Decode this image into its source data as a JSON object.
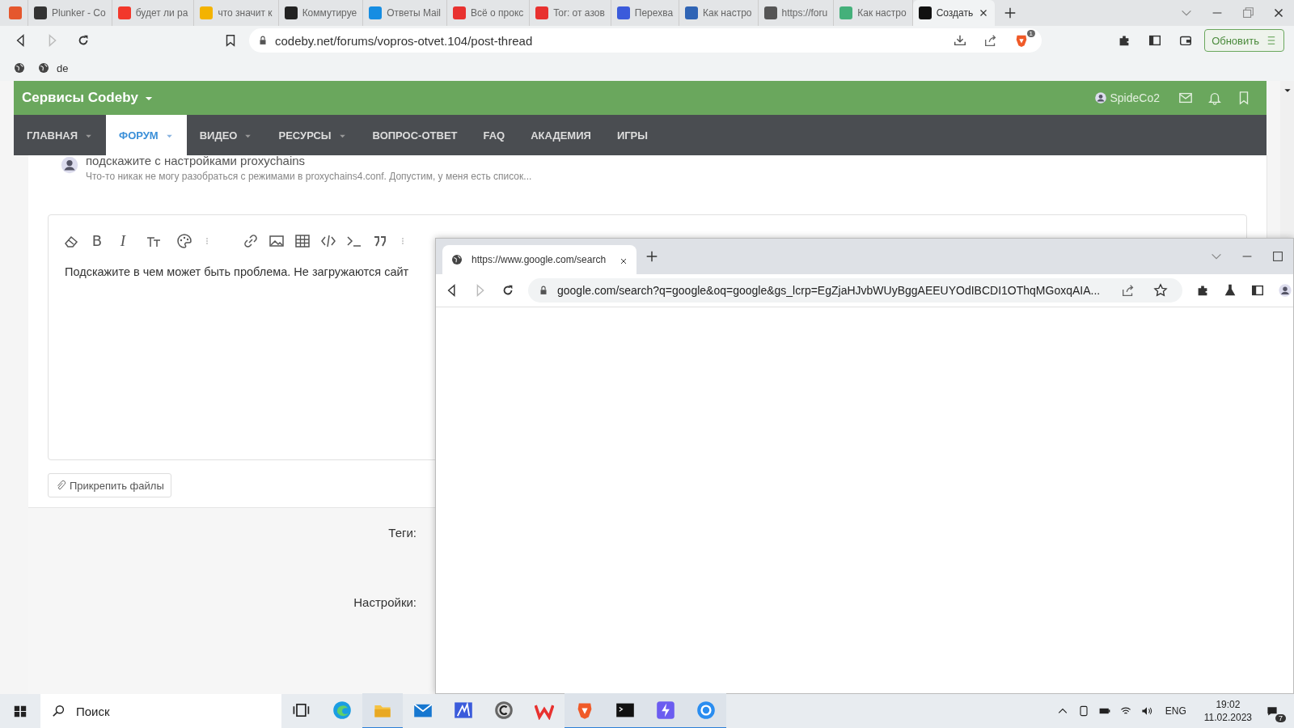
{
  "browser": {
    "tabs": [
      {
        "selected": false
      },
      {
        "label": "Plunker - Co",
        "selected": false
      },
      {
        "label": "будет ли ра",
        "selected": false
      },
      {
        "label": "что значит к",
        "selected": false
      },
      {
        "label": "Коммутируе",
        "selected": false
      },
      {
        "label": "Ответы Mail",
        "selected": false
      },
      {
        "label": "Всё о прокс",
        "selected": false
      },
      {
        "label": "Tor: от азов",
        "selected": false
      },
      {
        "label": "Перехва",
        "selected": false
      },
      {
        "label": "Как настро",
        "selected": false
      },
      {
        "label": "https://foru",
        "selected": false
      },
      {
        "label": "Как настро",
        "selected": false
      },
      {
        "label": "Создать",
        "selected": true
      }
    ],
    "url": "codeby.net/forums/vopros-otvet.104/post-thread",
    "extension_badge": "1",
    "update_button": "Обновить",
    "bookmarks": [
      {
        "kind": "icon"
      },
      {
        "kind": "link",
        "label": "de"
      }
    ]
  },
  "forum": {
    "brand": "Сервисы Codeby",
    "user": "SpideCo2",
    "nav": [
      {
        "label": "ГЛАВНАЯ",
        "selected": false,
        "dropdown": true
      },
      {
        "label": "ФОРУМ",
        "selected": true,
        "dropdown": true
      },
      {
        "label": "ВИДЕО",
        "selected": false,
        "dropdown": true
      },
      {
        "label": "РЕСУРСЫ",
        "selected": false,
        "dropdown": true
      },
      {
        "label": "ВОПРОС-ОТВЕТ",
        "selected": false,
        "dropdown": false
      },
      {
        "label": "FAQ",
        "selected": false,
        "dropdown": false
      },
      {
        "label": "АКАДЕМИЯ",
        "selected": false,
        "dropdown": false
      },
      {
        "label": "ИГРЫ",
        "selected": false,
        "dropdown": false
      }
    ],
    "similar_thread": {
      "title": "подскажите с настройками proxychains",
      "excerpt": "Что-то никак не могу разобраться с режимами в proxychains4.conf. Допустим, у меня есть список..."
    },
    "toolbar": [
      {
        "kind": "eraser"
      },
      {
        "kind": "bold",
        "label": "B"
      },
      {
        "kind": "italic",
        "label": "I"
      },
      {
        "kind": "textsize"
      },
      {
        "kind": "palette"
      },
      {
        "kind": "more"
      },
      {
        "kind": "link"
      },
      {
        "kind": "image"
      },
      {
        "kind": "table"
      },
      {
        "kind": "code"
      },
      {
        "kind": "terminal"
      },
      {
        "kind": "quote"
      },
      {
        "kind": "more"
      }
    ],
    "message": "Подскажите в чем может быть проблема. Не загружаются сайт",
    "attach_button": "Прикрепить файлы",
    "fields": [
      "Теги:",
      "Настройки:"
    ]
  },
  "popup": {
    "tab": "https://www.google.com/search",
    "url": "google.com/search?q=google&oq=google&gs_lcrp=EgZjaHJvbWUyBggAEEUYOdIBCDI1OThqMGoxqAIA..."
  },
  "taskbar": {
    "search_placeholder": "Поиск",
    "apps": [
      {
        "kind": "edge",
        "active": false
      },
      {
        "kind": "folder",
        "active": true
      },
      {
        "kind": "mail",
        "active": false
      },
      {
        "kind": "app",
        "active": false
      },
      {
        "kind": "c",
        "active": false
      },
      {
        "kind": "wps",
        "active": false
      },
      {
        "kind": "brave",
        "active": true
      },
      {
        "kind": "terminal",
        "active": true
      },
      {
        "kind": "bolt",
        "active": true
      },
      {
        "kind": "chrome",
        "active": true
      }
    ],
    "language": "ENG",
    "time": "19:02",
    "date": "11.02.2023",
    "notifications": "7"
  }
}
